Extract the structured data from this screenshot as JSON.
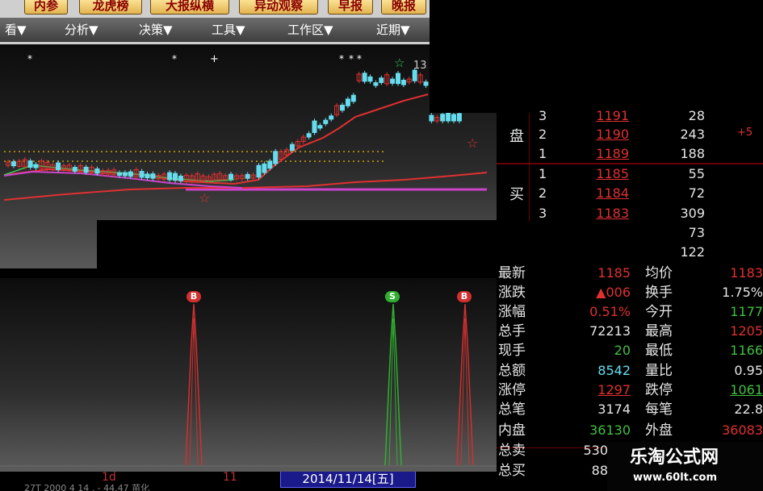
{
  "toolbar": {
    "buttons": [
      "内参",
      "龙虎榜",
      "大报纵横",
      "异动观察",
      "早报",
      "晚报"
    ],
    "menus": [
      "看▼",
      "分析▼",
      "决策▼",
      "工具▼",
      "工作区▼",
      "近期▼"
    ]
  },
  "kline": {
    "label_13": "13",
    "colors": {
      "up": "#e03030",
      "down": "#66ddee",
      "ma_long": "#e03030",
      "ma_short": "#33cc55",
      "support": "#cc44cc"
    }
  },
  "signals": [
    {
      "letter": "B",
      "color": "#d03030"
    },
    {
      "letter": "S",
      "color": "#30b030"
    },
    {
      "letter": "B",
      "color": "#d03030"
    }
  ],
  "bottombar": {
    "tab1": "1d",
    "tab2": "11",
    "date": "2014/11/14[五]",
    "partial_text": "27T   2000   4      14      .  -  44.47      苗化"
  },
  "orderbook": {
    "sell_label": "盘",
    "buy_label": "买",
    "rows": [
      {
        "level": "3",
        "price": "1191",
        "volume": "28"
      },
      {
        "level": "2",
        "price": "1190",
        "volume": "243"
      },
      {
        "level": "1",
        "price": "1189",
        "volume": "188"
      },
      {
        "level": "1",
        "price": "1185",
        "volume": "55"
      },
      {
        "level": "2",
        "price": "1184",
        "volume": "72"
      },
      {
        "level": "3",
        "price": "1183",
        "volume": "309"
      },
      {
        "level": "",
        "price": "",
        "volume": "73"
      },
      {
        "level": "",
        "price": "",
        "volume": "122"
      }
    ],
    "side_mark": "+5"
  },
  "stats": {
    "rows": [
      {
        "l1": "最新",
        "v1": "1185",
        "c1": "#e03030",
        "l2": "均价",
        "v2": "1183",
        "c2": "#e03030"
      },
      {
        "l1": "涨跌",
        "v1": "▲006",
        "c1": "#e03030",
        "l2": "换手",
        "v2": "1.75%",
        "c2": "#e6e6e6"
      },
      {
        "l1": "涨幅",
        "v1": "0.51%",
        "c1": "#e03030",
        "l2": "今开",
        "v2": "1177",
        "c2": "#40c040"
      },
      {
        "l1": "总手",
        "v1": "72213",
        "c1": "#e6e6e6",
        "l2": "最高",
        "v2": "1205",
        "c2": "#e03030"
      },
      {
        "l1": "现手",
        "v1": "20",
        "c1": "#40c040",
        "l2": "最低",
        "v2": "1166",
        "c2": "#40c040"
      },
      {
        "l1": "总额",
        "v1": "8542",
        "c1": "#66ddee",
        "l2": "量比",
        "v2": "0.95",
        "c2": "#e6e6e6"
      },
      {
        "l1": "涨停",
        "v1": "1297",
        "c1": "#e03030",
        "l2": "跌停",
        "v2": "1061",
        "c2": "#40c040"
      },
      {
        "l1": "总笔",
        "v1": "3174",
        "c1": "#e6e6e6",
        "l2": "每笔",
        "v2": "22.8",
        "c2": "#e6e6e6"
      },
      {
        "l1": "内盘",
        "v1": "36130",
        "c1": "#40c040",
        "l2": "外盘",
        "v2": "36083",
        "c2": "#e03030"
      },
      {
        "l1": "总卖",
        "v1": "530",
        "c1": "#e6e6e6",
        "l2": "",
        "v2": "",
        "c2": "#e6e6e6"
      },
      {
        "l1": "总买",
        "v1": "88",
        "c1": "#e6e6e6",
        "l2": "",
        "v2": "",
        "c2": "#e6e6e6"
      }
    ]
  },
  "watermark": {
    "title": "乐淘公式网",
    "url": "www.60lt.com"
  }
}
